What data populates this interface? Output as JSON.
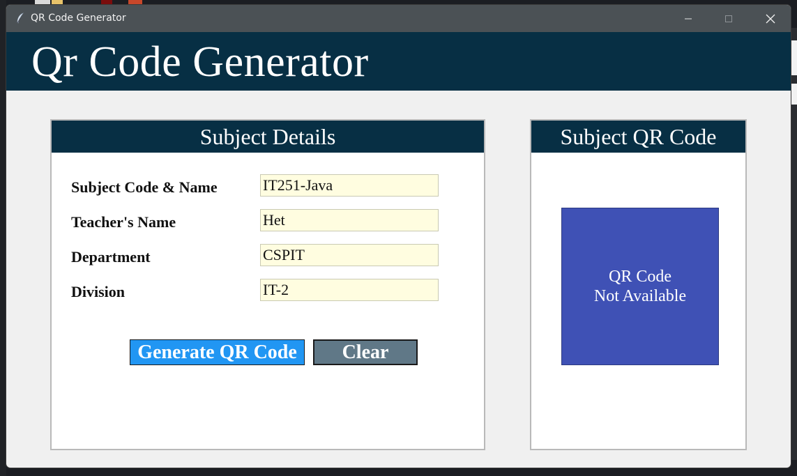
{
  "window": {
    "title": "QR Code Generator",
    "app_icon": "feather-icon",
    "controls": [
      "minimize-icon",
      "maximize-icon",
      "close-icon"
    ]
  },
  "header": {
    "heading": "Qr Code Generator"
  },
  "details_panel": {
    "title": "Subject Details",
    "fields": [
      {
        "label": "Subject Code & Name",
        "value": "IT251-Java"
      },
      {
        "label": "Teacher's Name",
        "value": "Het"
      },
      {
        "label": "Department",
        "value": "CSPIT"
      },
      {
        "label": "Division",
        "value": "IT-2"
      }
    ],
    "generate_label": "Generate QR Code",
    "clear_label": "Clear"
  },
  "qr_panel": {
    "title": "Subject QR Code",
    "placeholder_line1": "QR Code",
    "placeholder_line2": "Not Available"
  },
  "colors": {
    "header_bg": "#072f44",
    "field_bg": "#fffde0",
    "generate_btn": "#2196f3",
    "clear_btn": "#607887",
    "qr_placeholder": "#3f51b5",
    "titlebar": "#4b5155"
  }
}
